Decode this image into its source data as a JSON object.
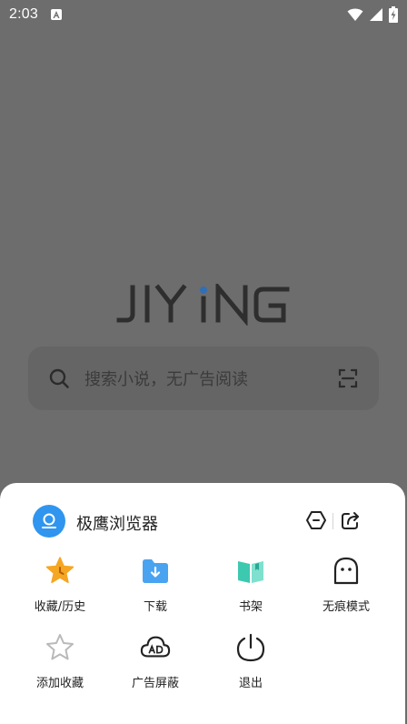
{
  "status_bar": {
    "time": "2:03",
    "app_icon": "a-letter-icon",
    "icons": [
      "wifi-icon",
      "signal-icon",
      "battery-charging-icon"
    ]
  },
  "home": {
    "logo_text": "JIYiNG",
    "search": {
      "placeholder": "搜索小说，无广告阅读",
      "left_icon": "search-icon",
      "right_icon": "scan-icon"
    }
  },
  "menu": {
    "app_name": "极鹰浏览器",
    "header_icons": [
      "settings-hex-icon",
      "share-icon"
    ],
    "items": [
      {
        "label": "收藏/历史",
        "icon": "star-clock-icon"
      },
      {
        "label": "下载",
        "icon": "download-folder-icon"
      },
      {
        "label": "书架",
        "icon": "bookshelf-icon"
      },
      {
        "label": "无痕模式",
        "icon": "ghost-icon"
      },
      {
        "label": "添加收藏",
        "icon": "star-outline-icon"
      },
      {
        "label": "广告屏蔽",
        "icon": "ad-block-cloud-icon"
      },
      {
        "label": "退出",
        "icon": "power-icon"
      }
    ]
  },
  "colors": {
    "overlay_bg": "#6d6d6d",
    "sheet_bg": "#ffffff",
    "accent_blue": "#2f95ef",
    "star_orange": "#f5a623",
    "folder_blue": "#4aa3f0",
    "book_teal": "#3cc9b0"
  }
}
